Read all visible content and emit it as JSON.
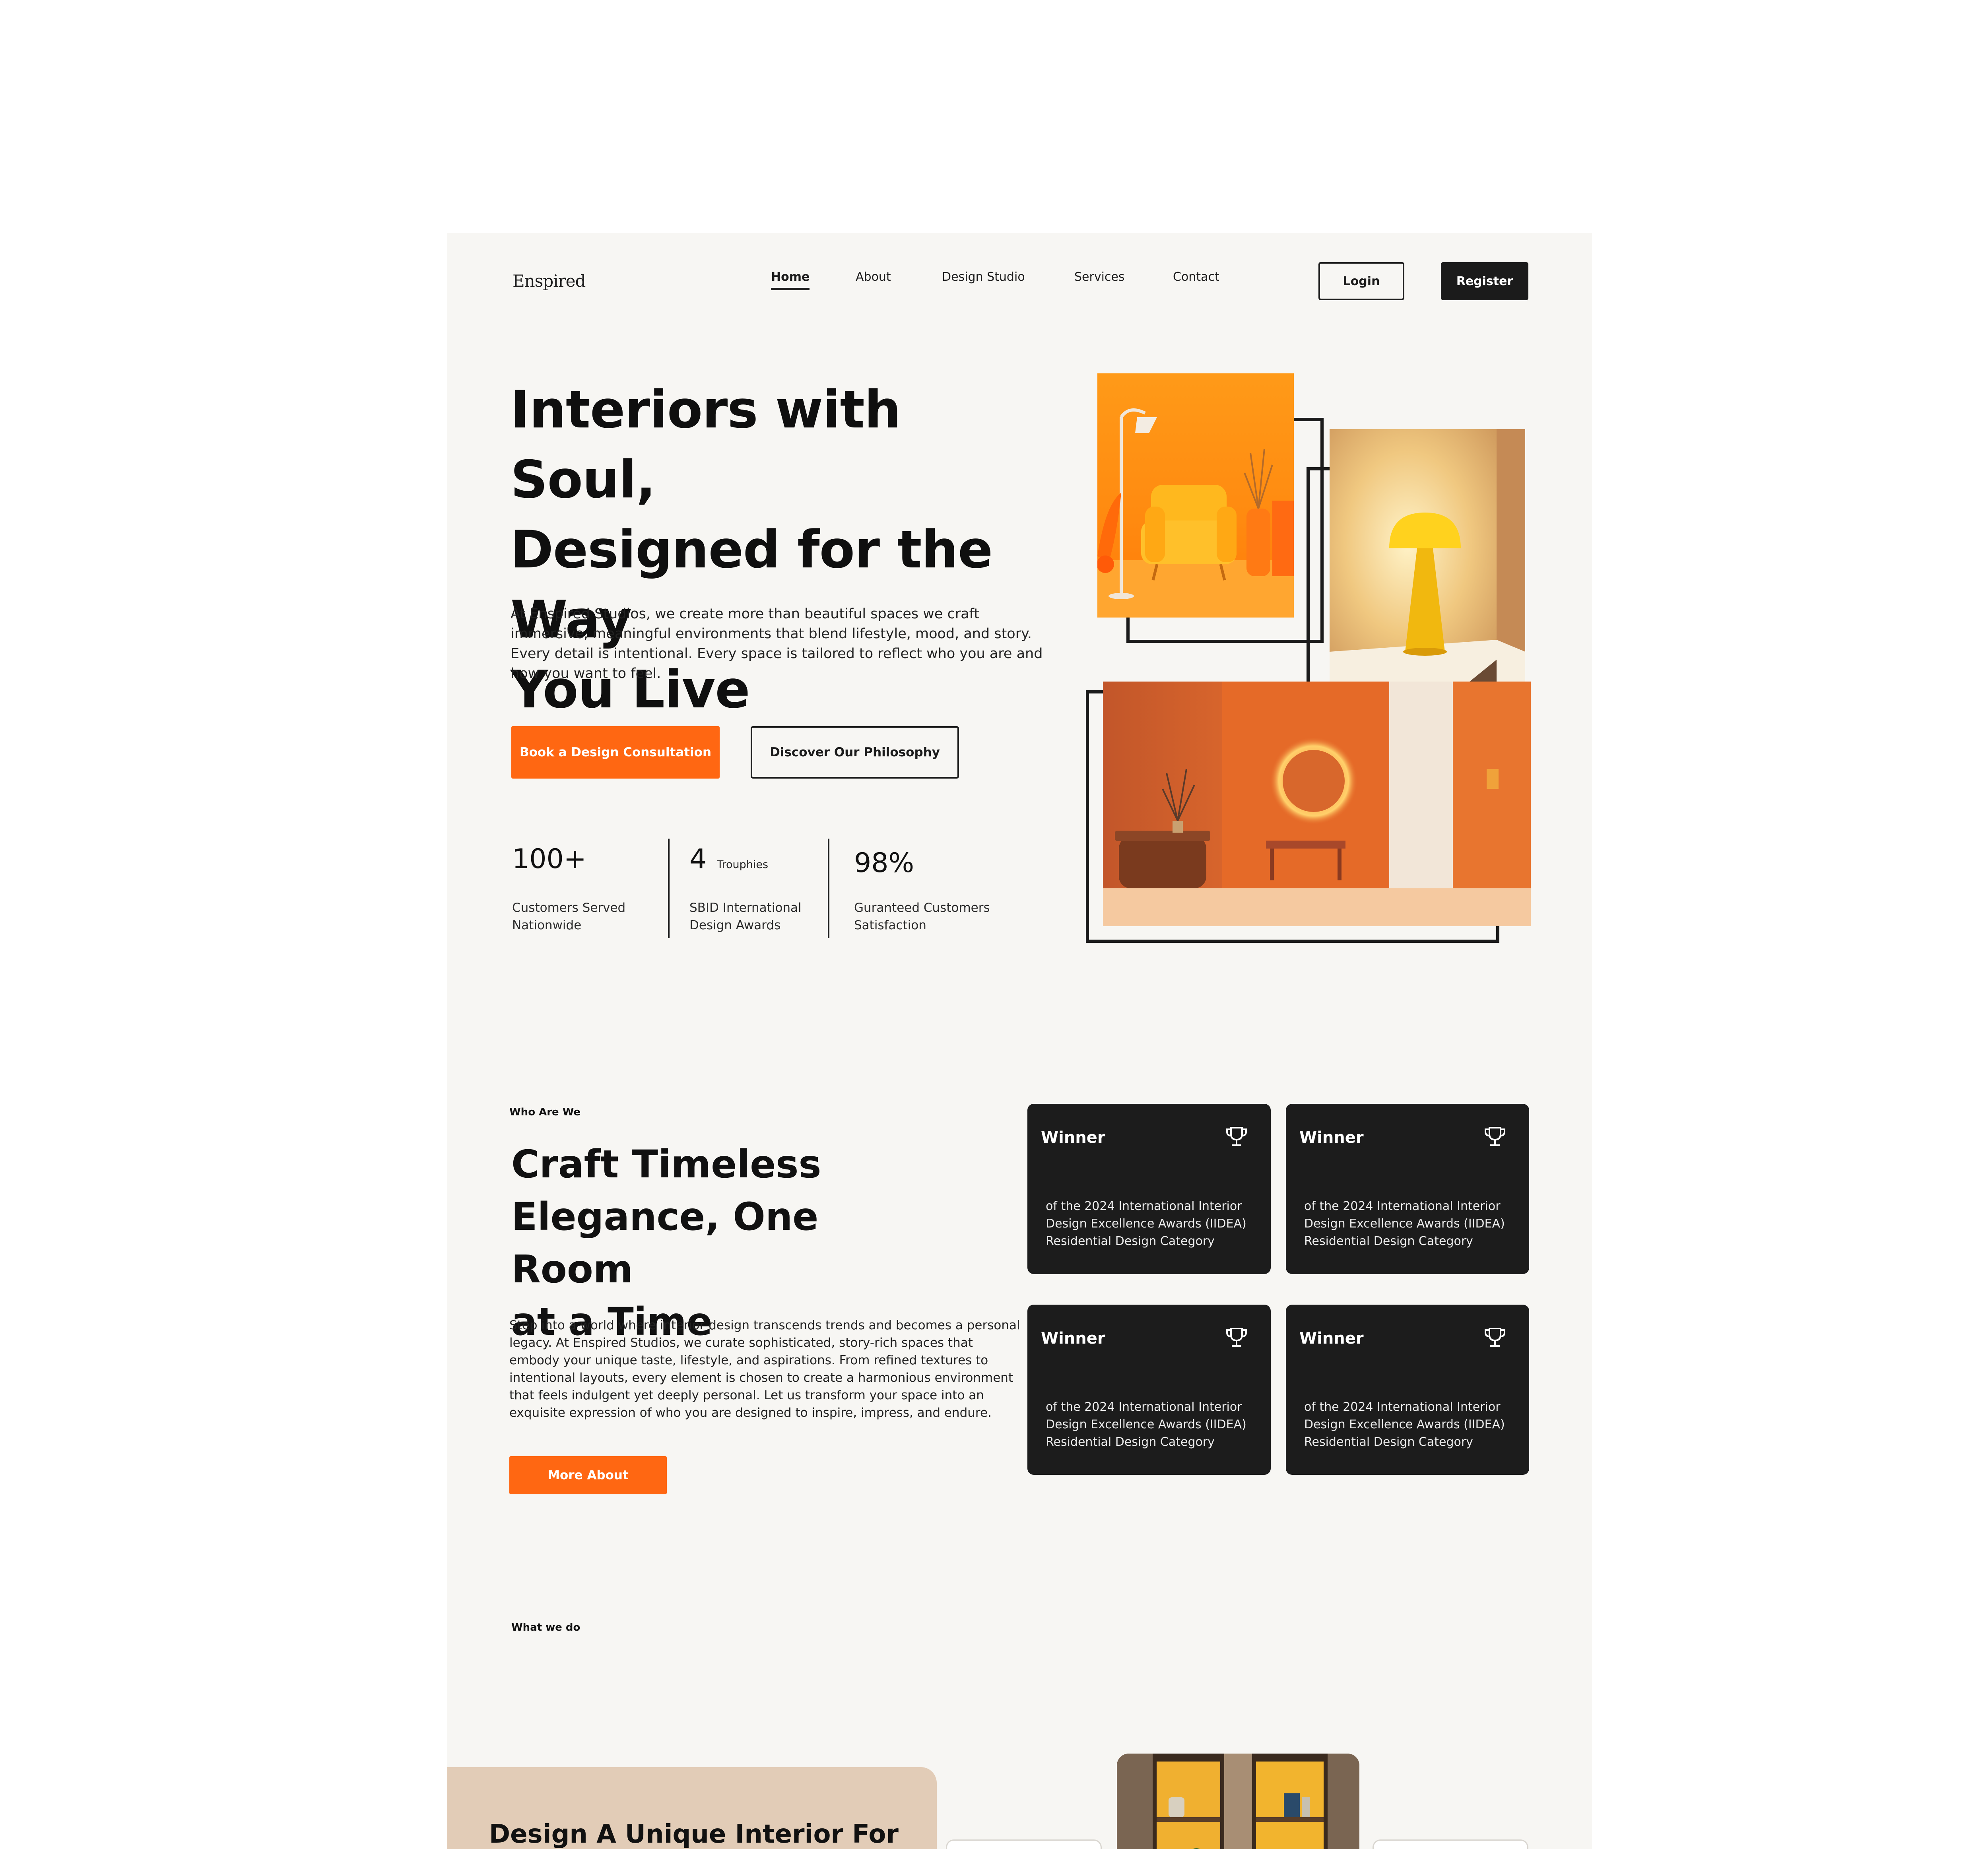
{
  "nav": {
    "logo": "Enspired",
    "links": [
      "Home",
      "About",
      "Design Studio",
      "Services",
      "Contact"
    ],
    "login": "Login",
    "register": "Register"
  },
  "hero": {
    "title_lines": [
      "Interiors with Soul,",
      "Designed for the Way",
      "You Live"
    ],
    "description": "At Enspired Studios, we create more than beautiful spaces  we craft immersive, meaningful environments that blend lifestyle, mood, and story. Every detail is intentional. Every space is tailored to reflect who you are and how you want to feel.",
    "primary_cta": "Book a Design Consultation",
    "secondary_cta": "Discover Our Philosophy",
    "stats": [
      {
        "value": "100+",
        "suffix": "",
        "label_lines": [
          "Customers Served",
          "Nationwide"
        ]
      },
      {
        "value": "4",
        "suffix": "Trouphies",
        "label_lines": [
          "SBID International",
          "Design Awards"
        ]
      },
      {
        "value": "98%",
        "suffix": "",
        "label_lines": [
          "Guranteed Customers",
          "Satisfaction"
        ]
      }
    ]
  },
  "about": {
    "eyebrow": "Who Are We",
    "title_lines": [
      "Craft Timeless",
      "Elegance, One Room",
      "at a Time"
    ],
    "description": "Step into a world where interior design transcends trends and becomes a personal legacy. At Enspired Studios, we curate sophisticated, story-rich spaces that embody your unique taste, lifestyle, and aspirations. From refined textures to intentional layouts, every element is chosen to create a harmonious environment that feels indulgent yet deeply personal. Let us transform your space into an exquisite expression of who you are designed to inspire, impress, and endure.",
    "cta": "More About",
    "awards": [
      {
        "title": "Winner",
        "icon": "trophy-icon",
        "lines": [
          "of the 2024 International Interior",
          "Design Excellence Awards (IIDEA)",
          "Residential Design Category"
        ]
      },
      {
        "title": "Winner",
        "icon": "trophy-icon",
        "lines": [
          "of the 2024 International Interior",
          "Design Excellence Awards (IIDEA)",
          "Residential Design Category"
        ]
      },
      {
        "title": "Winner",
        "icon": "trophy-icon",
        "lines": [
          "of the 2024 International Interior",
          "Design Excellence Awards (IIDEA)",
          "Residential Design Category"
        ]
      },
      {
        "title": "Winner",
        "icon": "trophy-icon",
        "lines": [
          "of the 2024 International Interior",
          "Design Excellence Awards (IIDEA)",
          "Residential Design Category"
        ]
      }
    ]
  },
  "services": {
    "eyebrow": "What we do",
    "title": "Design A Unique Interior For"
  },
  "colors": {
    "accent": "#ff6712",
    "dark": "#1c1c1c",
    "page_bg": "#f7f6f3",
    "tan": "#e2ccb7"
  }
}
